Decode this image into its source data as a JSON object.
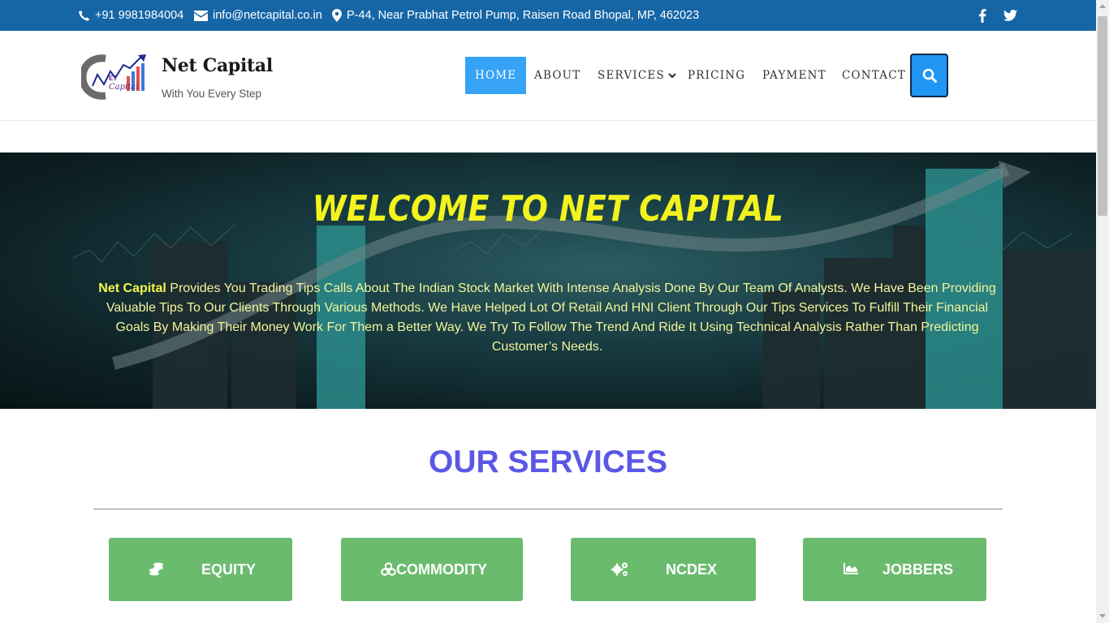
{
  "topbar": {
    "phone": "+91 9981984004",
    "email": "info@netcapital.co.in",
    "address": "P-44, Near Prabhat Petrol Pump, Raisen Road Bhopal, MP, 462023",
    "social": [
      "facebook-icon",
      "twitter-icon"
    ],
    "color": "#1666a6"
  },
  "brand": {
    "name": "Net Capital",
    "tagline": "With You Every Step",
    "logo_text": "Capital"
  },
  "nav": {
    "items": [
      {
        "label": "HOME",
        "active": true
      },
      {
        "label": "ABOUT"
      },
      {
        "label": "SERVICES",
        "has_dropdown": true
      },
      {
        "label": "PRICING"
      },
      {
        "label": "PAYMENT"
      },
      {
        "label": "CONTACT"
      }
    ],
    "search_icon": "search-icon",
    "active_color": "#36a3f7"
  },
  "hero": {
    "title": "WELCOME TO NET CAPITAL",
    "text_bold": "Net Capital",
    "text_body": " Provides You Trading Tips Calls About The Indian Stock Market With Intense Analysis Done By Our Team Of Analysts. We Have Been Providing Valuable Tips To Our Clients Through Various Methods. We Have Helped Lot Of Retail And HNI Client Through Our Tips Services To Fulfill Their Financial Goals By Making Their Money Work For Them a Better Way. We Try To Follow The Trend And Ride It Using Technical Analysis Rather Than Predicting Customer’s Needs.",
    "title_color": "#f2f31e"
  },
  "services": {
    "title": "OUR SERVICES",
    "title_color": "#5b57e6",
    "button_color": "#6bbb6e",
    "items": [
      {
        "label": "EQUITY",
        "icon": "coins-icon"
      },
      {
        "label": "COMMODITY",
        "icon": "cubes-icon"
      },
      {
        "label": "NCDEX",
        "icon": "gears-icon"
      },
      {
        "label": "JOBBERS",
        "icon": "area-chart-icon"
      }
    ]
  }
}
